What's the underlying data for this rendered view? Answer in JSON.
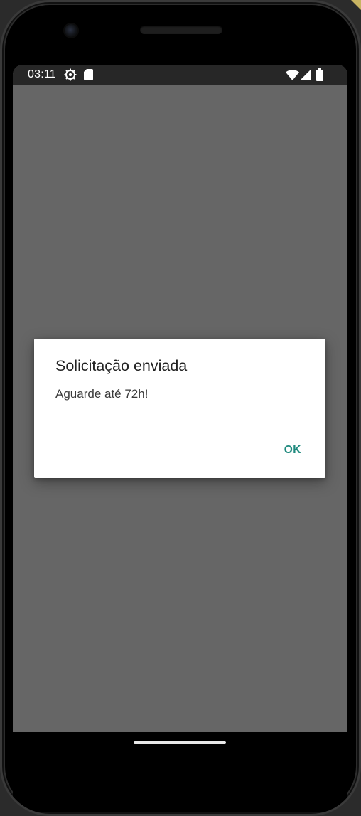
{
  "status_bar": {
    "time": "03:11",
    "icons": [
      "settings-gear-icon",
      "sd-card-icon",
      "wifi-icon",
      "cellular-signal-icon",
      "battery-icon"
    ],
    "background_color": "#272727"
  },
  "screen": {
    "background_color": "#666666"
  },
  "dialog": {
    "title": "Solicitação enviada",
    "message": "Aguarde até 72h!",
    "ok_button_label": "OK",
    "accent_color": "#1f8a7e"
  }
}
